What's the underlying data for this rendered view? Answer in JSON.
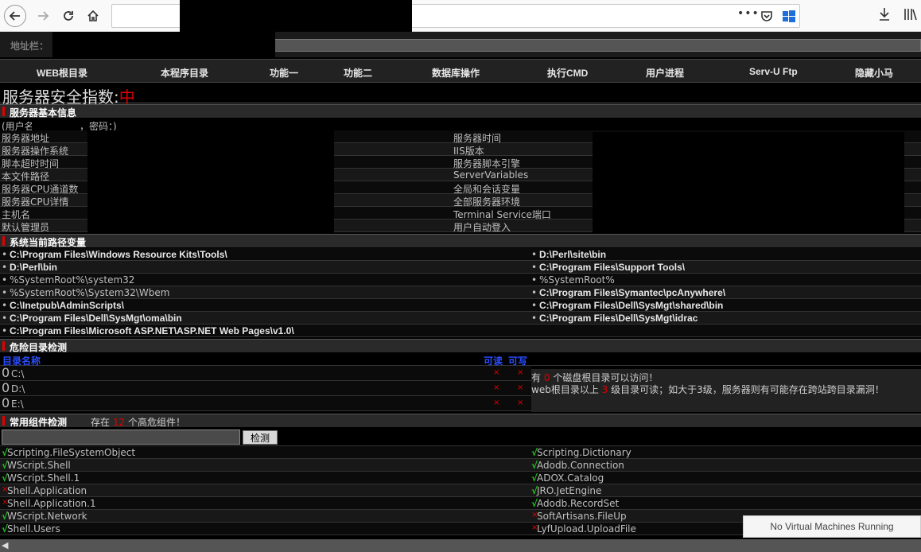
{
  "browser": {
    "icons": [
      "back-arrow-icon",
      "forward-arrow-icon",
      "reload-icon",
      "home-icon",
      "more-icon",
      "pocket-icon",
      "windows-icon",
      "download-icon",
      "library-icon"
    ]
  },
  "address": {
    "label": "地址栏："
  },
  "nav": [
    "WEB根目录",
    "本程序目录",
    "功能一",
    "功能二",
    "数据库操作",
    "执行CMD",
    "用户进程",
    "Serv-U Ftp",
    "隐藏小马"
  ],
  "security": {
    "label": "服务器安全指数:",
    "value": "中"
  },
  "basic_info": {
    "title": "服务器基本信息",
    "user_line_a": "(用户名",
    "user_line_b": "，密码：)",
    "left_labels": [
      "服务器地址",
      "服务器操作系统",
      "脚本超时时间",
      "本文件路径",
      "服务器CPU通道数",
      "服务器CPU详情",
      "主机名",
      "默认管理员"
    ],
    "right_labels": [
      "服务器时间",
      "IIS版本",
      "服务器脚本引擎",
      "ServerVariables",
      "全局和会话变量",
      "全部服务器环境",
      "Terminal Service端口",
      "用户自动登入"
    ]
  },
  "path_vars": {
    "title": "系统当前路径变量",
    "left": [
      {
        "text": "C:\\Program Files\\Windows Resource Kits\\Tools\\",
        "bold": true
      },
      {
        "text": "D:\\Perl\\bin",
        "bold": true
      },
      {
        "text": "%SystemRoot%\\system32",
        "bold": false
      },
      {
        "text": "%SystemRoot%\\System32\\Wbem",
        "bold": false
      },
      {
        "text": "C:\\Inetpub\\AdminScripts\\",
        "bold": true
      },
      {
        "text": "C:\\Program Files\\Dell\\SysMgt\\oma\\bin",
        "bold": true
      },
      {
        "text": "C:\\Program Files\\Microsoft ASP.NET\\ASP.NET Web Pages\\v1.0\\",
        "bold": true
      }
    ],
    "right": [
      {
        "text": "D:\\Perl\\site\\bin",
        "bold": true
      },
      {
        "text": "C:\\Program Files\\Support Tools\\",
        "bold": true
      },
      {
        "text": "%SystemRoot%",
        "bold": false
      },
      {
        "text": "C:\\Program Files\\Symantec\\pcAnywhere\\",
        "bold": true
      },
      {
        "text": "C:\\Program Files\\Dell\\SysMgt\\shared\\bin",
        "bold": true
      },
      {
        "text": "C:\\Program Files\\Dell\\SysMgt\\idrac",
        "bold": true
      }
    ]
  },
  "danger_dirs": {
    "title": "危险目录检测",
    "col_name": "目录名称",
    "col_read": "可读",
    "col_write": "可写",
    "dirs": [
      {
        "num": "0",
        "path": "C:\\",
        "read": "×",
        "write": "×"
      },
      {
        "num": "0",
        "path": "D:\\",
        "read": "×",
        "write": "×"
      },
      {
        "num": "0",
        "path": "E:\\",
        "read": "×",
        "write": "×"
      }
    ],
    "note1_a": "有",
    "note1_count": "0",
    "note1_b": "个磁盘根目录可以访问！",
    "note2_a": "web根目录以上",
    "note2_count": "3",
    "note2_b": "级目录可读；如大于3级，服务器则有可能存在跨站跨目录漏洞！"
  },
  "components": {
    "title": "常用组件检测",
    "summary_a": "存在",
    "summary_count": "12",
    "summary_b": "个高危组件！",
    "check_button": "检测",
    "left": [
      {
        "mark": "√",
        "ok": true,
        "name": "Scripting.FileSystemObject"
      },
      {
        "mark": "√",
        "ok": true,
        "name": "WScript.Shell"
      },
      {
        "mark": "√",
        "ok": true,
        "name": "WScript.Shell.1"
      },
      {
        "mark": "×",
        "ok": false,
        "name": "Shell.Application"
      },
      {
        "mark": "×",
        "ok": false,
        "name": "Shell.Application.1"
      },
      {
        "mark": "√",
        "ok": true,
        "name": "WScript.Network"
      },
      {
        "mark": "√",
        "ok": true,
        "name": "Shell.Users"
      }
    ],
    "right": [
      {
        "mark": "√",
        "ok": true,
        "name": "Scripting.Dictionary"
      },
      {
        "mark": "√",
        "ok": true,
        "name": "Adodb.Connection"
      },
      {
        "mark": "√",
        "ok": true,
        "name": "ADOX.Catalog"
      },
      {
        "mark": "√",
        "ok": true,
        "name": "JRO.JetEngine"
      },
      {
        "mark": "√",
        "ok": true,
        "name": "Adodb.RecordSet"
      },
      {
        "mark": "×",
        "ok": false,
        "name": "SoftArtisans.FileUp"
      },
      {
        "mark": "×",
        "ok": false,
        "name": "LyfUpload.UploadFile"
      }
    ]
  },
  "toast": "No Virtual Machines Running",
  "colors": {
    "danger": "#e00000",
    "ok": "#22c322",
    "header_blue": "#2a4dff"
  }
}
